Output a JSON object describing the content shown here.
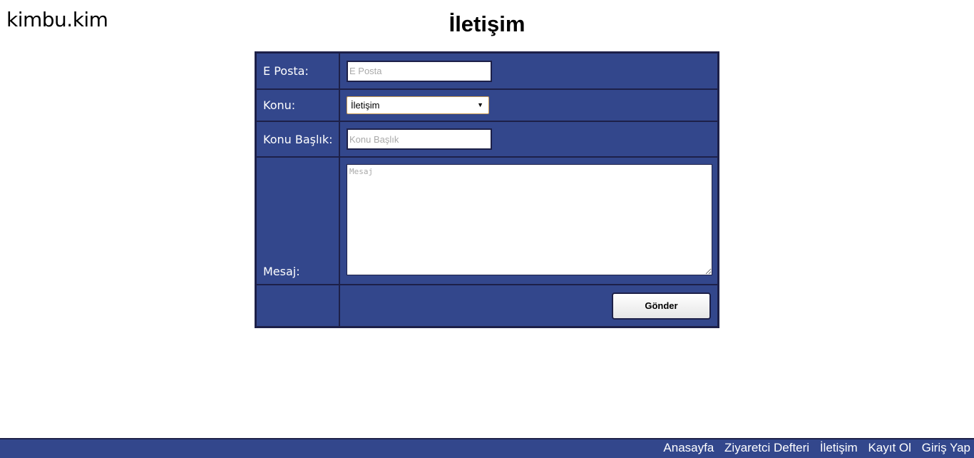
{
  "header": {
    "logo_text": "kimbu.kim",
    "page_title": "İletişim"
  },
  "form": {
    "email": {
      "label": "E Posta:",
      "placeholder": "E Posta",
      "value": ""
    },
    "topic": {
      "label": "Konu:",
      "selected": "İletişim",
      "arrow": "▼"
    },
    "subject": {
      "label": "Konu Başlık:",
      "placeholder": "Konu Başlık",
      "value": ""
    },
    "message": {
      "label": "Mesaj:",
      "placeholder": "Mesaj",
      "value": ""
    },
    "submit_label": "Gönder"
  },
  "footer": {
    "links": [
      "Anasayfa",
      "Ziyaretci Defteri",
      "İletişim",
      "Kayıt Ol",
      "Giriş Yap"
    ]
  },
  "colors": {
    "panel": "#33478c",
    "border": "#1d2048",
    "background": "#ffffff"
  }
}
